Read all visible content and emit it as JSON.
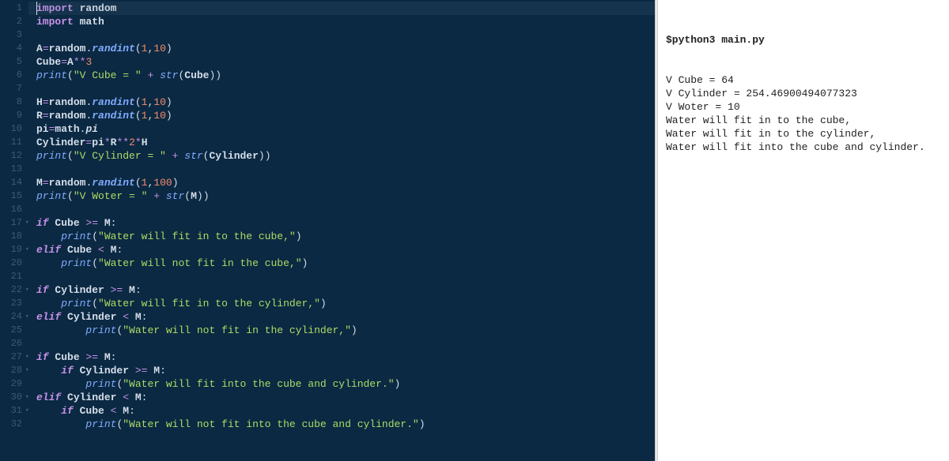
{
  "editor": {
    "lines": [
      {
        "n": 1,
        "fold": false,
        "tokens": [
          [
            "kw-import",
            "import"
          ],
          [
            "",
            ""
          ],
          [
            "ident",
            " random"
          ]
        ]
      },
      {
        "n": 2,
        "fold": false,
        "tokens": [
          [
            "kw-import",
            "import"
          ],
          [
            "ident",
            " math"
          ]
        ]
      },
      {
        "n": 3,
        "fold": false,
        "tokens": []
      },
      {
        "n": 4,
        "fold": false,
        "tokens": [
          [
            "ident",
            "A"
          ],
          [
            "op",
            "="
          ],
          [
            "ident",
            "random"
          ],
          [
            "punct",
            "."
          ],
          [
            "func",
            "randint"
          ],
          [
            "punct",
            "("
          ],
          [
            "num",
            "1"
          ],
          [
            "punct",
            ","
          ],
          [
            "num",
            "10"
          ],
          [
            "punct",
            ")"
          ]
        ]
      },
      {
        "n": 5,
        "fold": false,
        "tokens": [
          [
            "ident",
            "Cube"
          ],
          [
            "op",
            "="
          ],
          [
            "ident",
            "A"
          ],
          [
            "op",
            "**"
          ],
          [
            "num",
            "3"
          ]
        ]
      },
      {
        "n": 6,
        "fold": false,
        "tokens": [
          [
            "builtin",
            "print"
          ],
          [
            "punct",
            "("
          ],
          [
            "str",
            "\"V Cube = \""
          ],
          [
            "op",
            " + "
          ],
          [
            "builtin",
            "str"
          ],
          [
            "punct",
            "("
          ],
          [
            "ident",
            "Cube"
          ],
          [
            "punct",
            "))"
          ]
        ]
      },
      {
        "n": 7,
        "fold": false,
        "tokens": []
      },
      {
        "n": 8,
        "fold": false,
        "tokens": [
          [
            "ident",
            "H"
          ],
          [
            "op",
            "="
          ],
          [
            "ident",
            "random"
          ],
          [
            "punct",
            "."
          ],
          [
            "func",
            "randint"
          ],
          [
            "punct",
            "("
          ],
          [
            "num",
            "1"
          ],
          [
            "punct",
            ","
          ],
          [
            "num",
            "10"
          ],
          [
            "punct",
            ")"
          ]
        ]
      },
      {
        "n": 9,
        "fold": false,
        "tokens": [
          [
            "ident",
            "R"
          ],
          [
            "op",
            "="
          ],
          [
            "ident",
            "random"
          ],
          [
            "punct",
            "."
          ],
          [
            "func",
            "randint"
          ],
          [
            "punct",
            "("
          ],
          [
            "num",
            "1"
          ],
          [
            "punct",
            ","
          ],
          [
            "num",
            "10"
          ],
          [
            "punct",
            ")"
          ]
        ]
      },
      {
        "n": 10,
        "fold": false,
        "tokens": [
          [
            "ident",
            "pi"
          ],
          [
            "op",
            "="
          ],
          [
            "ident",
            "math"
          ],
          [
            "punct",
            "."
          ],
          [
            "ident-it",
            "pi"
          ]
        ]
      },
      {
        "n": 11,
        "fold": false,
        "tokens": [
          [
            "ident",
            "Cylinder"
          ],
          [
            "op",
            "="
          ],
          [
            "ident",
            "pi"
          ],
          [
            "op",
            "*"
          ],
          [
            "ident",
            "R"
          ],
          [
            "op",
            "**"
          ],
          [
            "num",
            "2"
          ],
          [
            "op",
            "*"
          ],
          [
            "ident",
            "H"
          ]
        ]
      },
      {
        "n": 12,
        "fold": false,
        "tokens": [
          [
            "builtin",
            "print"
          ],
          [
            "punct",
            "("
          ],
          [
            "str",
            "\"V Cylinder = \""
          ],
          [
            "op",
            " + "
          ],
          [
            "builtin",
            "str"
          ],
          [
            "punct",
            "("
          ],
          [
            "ident",
            "Cylinder"
          ],
          [
            "punct",
            "))"
          ]
        ]
      },
      {
        "n": 13,
        "fold": false,
        "tokens": []
      },
      {
        "n": 14,
        "fold": false,
        "tokens": [
          [
            "ident",
            "M"
          ],
          [
            "op",
            "="
          ],
          [
            "ident",
            "random"
          ],
          [
            "punct",
            "."
          ],
          [
            "func",
            "randint"
          ],
          [
            "punct",
            "("
          ],
          [
            "num",
            "1"
          ],
          [
            "punct",
            ","
          ],
          [
            "num",
            "100"
          ],
          [
            "punct",
            ")"
          ]
        ]
      },
      {
        "n": 15,
        "fold": false,
        "tokens": [
          [
            "builtin",
            "print"
          ],
          [
            "punct",
            "("
          ],
          [
            "str",
            "\"V Woter = \""
          ],
          [
            "op",
            " + "
          ],
          [
            "builtin",
            "str"
          ],
          [
            "punct",
            "("
          ],
          [
            "ident",
            "M"
          ],
          [
            "punct",
            "))"
          ]
        ]
      },
      {
        "n": 16,
        "fold": false,
        "tokens": []
      },
      {
        "n": 17,
        "fold": true,
        "tokens": [
          [
            "kw-ctrl",
            "if"
          ],
          [
            "ident",
            " Cube "
          ],
          [
            "op",
            ">="
          ],
          [
            "ident",
            " M"
          ],
          [
            "punct",
            ":"
          ]
        ]
      },
      {
        "n": 18,
        "fold": false,
        "tokens": [
          [
            "",
            "    "
          ],
          [
            "builtin",
            "print"
          ],
          [
            "punct",
            "("
          ],
          [
            "str",
            "\"Water will fit in to the cube,\""
          ],
          [
            "punct",
            ")"
          ]
        ]
      },
      {
        "n": 19,
        "fold": true,
        "tokens": [
          [
            "kw-ctrl",
            "elif"
          ],
          [
            "ident",
            " Cube "
          ],
          [
            "op",
            "<"
          ],
          [
            "ident",
            " M"
          ],
          [
            "punct",
            ":"
          ]
        ]
      },
      {
        "n": 20,
        "fold": false,
        "tokens": [
          [
            "",
            "    "
          ],
          [
            "builtin",
            "print"
          ],
          [
            "punct",
            "("
          ],
          [
            "str",
            "\"Water will not fit in the cube,\""
          ],
          [
            "punct",
            ")"
          ]
        ]
      },
      {
        "n": 21,
        "fold": false,
        "tokens": []
      },
      {
        "n": 22,
        "fold": true,
        "tokens": [
          [
            "kw-ctrl",
            "if"
          ],
          [
            "ident",
            " Cylinder "
          ],
          [
            "op",
            ">="
          ],
          [
            "ident",
            " M"
          ],
          [
            "punct",
            ":"
          ]
        ]
      },
      {
        "n": 23,
        "fold": false,
        "tokens": [
          [
            "",
            "    "
          ],
          [
            "builtin",
            "print"
          ],
          [
            "punct",
            "("
          ],
          [
            "str",
            "\"Water will fit in to the cylinder,\""
          ],
          [
            "punct",
            ")"
          ]
        ]
      },
      {
        "n": 24,
        "fold": true,
        "tokens": [
          [
            "kw-ctrl",
            "elif"
          ],
          [
            "ident",
            " Cylinder "
          ],
          [
            "op",
            "<"
          ],
          [
            "ident",
            " M"
          ],
          [
            "punct",
            ":"
          ]
        ]
      },
      {
        "n": 25,
        "fold": false,
        "tokens": [
          [
            "",
            "        "
          ],
          [
            "builtin",
            "print"
          ],
          [
            "punct",
            "("
          ],
          [
            "str",
            "\"Water will not fit in the cylinder,\""
          ],
          [
            "punct",
            ")"
          ]
        ]
      },
      {
        "n": 26,
        "fold": false,
        "tokens": []
      },
      {
        "n": 27,
        "fold": true,
        "tokens": [
          [
            "kw-ctrl",
            "if"
          ],
          [
            "ident",
            " Cube "
          ],
          [
            "op",
            ">="
          ],
          [
            "ident",
            " M"
          ],
          [
            "punct",
            ":"
          ]
        ]
      },
      {
        "n": 28,
        "fold": true,
        "tokens": [
          [
            "",
            "    "
          ],
          [
            "kw-ctrl",
            "if"
          ],
          [
            "ident",
            " Cylinder "
          ],
          [
            "op",
            ">="
          ],
          [
            "ident",
            " M"
          ],
          [
            "punct",
            ":"
          ]
        ]
      },
      {
        "n": 29,
        "fold": false,
        "tokens": [
          [
            "",
            "        "
          ],
          [
            "builtin",
            "print"
          ],
          [
            "punct",
            "("
          ],
          [
            "str",
            "\"Water will fit into the cube and cylinder.\""
          ],
          [
            "punct",
            ")"
          ]
        ]
      },
      {
        "n": 30,
        "fold": true,
        "tokens": [
          [
            "kw-ctrl",
            "elif"
          ],
          [
            "ident",
            " Cylinder "
          ],
          [
            "op",
            "<"
          ],
          [
            "ident",
            " M"
          ],
          [
            "punct",
            ":"
          ]
        ]
      },
      {
        "n": 31,
        "fold": true,
        "tokens": [
          [
            "",
            "    "
          ],
          [
            "kw-ctrl",
            "if"
          ],
          [
            "ident",
            " Cube "
          ],
          [
            "op",
            "<"
          ],
          [
            "ident",
            " M"
          ],
          [
            "punct",
            ":"
          ]
        ]
      },
      {
        "n": 32,
        "fold": false,
        "tokens": [
          [
            "",
            "        "
          ],
          [
            "builtin",
            "print"
          ],
          [
            "punct",
            "("
          ],
          [
            "str",
            "\"Water will not fit into the cube and cylinder.\""
          ],
          [
            "punct",
            ")"
          ]
        ]
      }
    ]
  },
  "output": {
    "command": "$python3 main.py",
    "lines": [
      "V Cube = 64",
      "V Cylinder = 254.46900494077323",
      "V Woter = 10",
      "Water will fit in to the cube,",
      "Water will fit in to the cylinder,",
      "Water will fit into the cube and cylinder."
    ]
  }
}
